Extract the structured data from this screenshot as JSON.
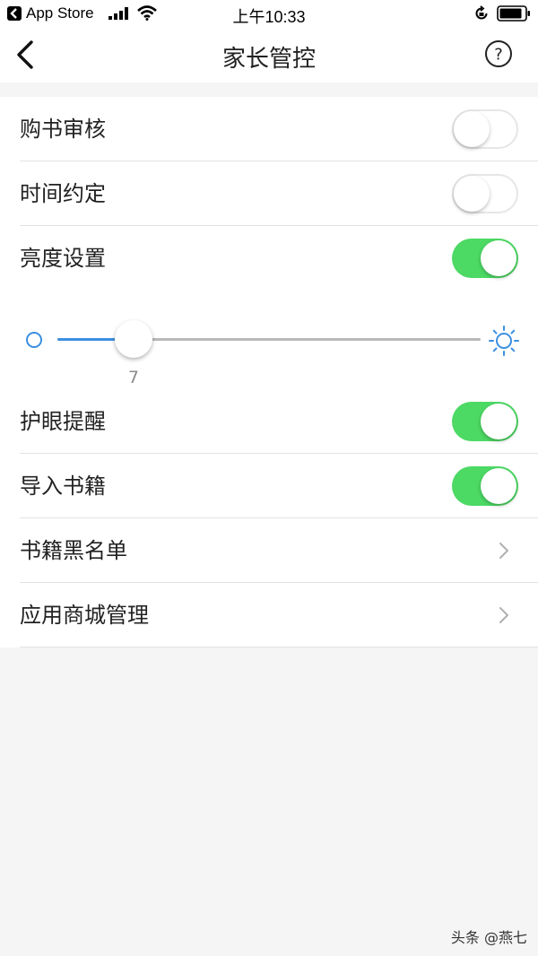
{
  "status_bar": {
    "back_app": "App Store",
    "time": "上午10:33"
  },
  "nav": {
    "title": "家长管控",
    "back_icon": "chevron-left-icon",
    "help_icon": "question-circle-icon"
  },
  "settings": [
    {
      "label": "购书审核",
      "control": "toggle",
      "on": false
    },
    {
      "label": "时间约定",
      "control": "toggle",
      "on": false
    },
    {
      "label": "亮度设置",
      "control": "toggle",
      "on": true
    },
    {
      "label": "护眼提醒",
      "control": "toggle",
      "on": true
    },
    {
      "label": "导入书籍",
      "control": "toggle",
      "on": true
    },
    {
      "label": "书籍黑名单",
      "control": "chevron"
    },
    {
      "label": "应用商城管理",
      "control": "chevron"
    }
  ],
  "brightness_slider": {
    "value": "7",
    "fraction": 0.18
  },
  "colors": {
    "toggle_on": "#4cd964",
    "slider_fill": "#3b8fe0",
    "background": "#f5f5f5"
  },
  "watermark": "头条 @燕七"
}
